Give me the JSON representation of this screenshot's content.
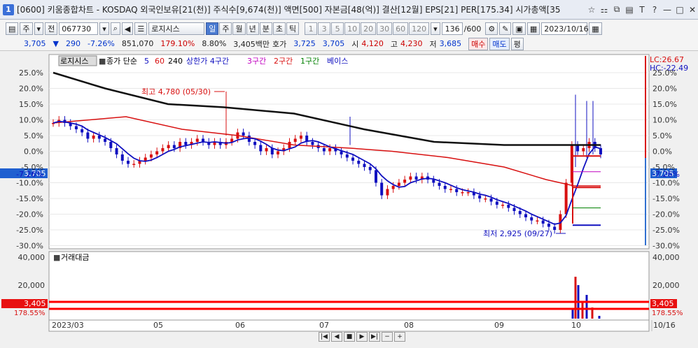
{
  "window": {
    "badge": "1",
    "title": "[0600] 키움종합차트 - KOSDAQ 외국인보유[21(천)] 주식수[9,674(천)] 액면[500] 자본금[48(억)] 결산[12월] EPS[21] PER[175.34] 시가총액[35"
  },
  "toolbar": {
    "market": "주",
    "prev_label": "전",
    "code": "067730",
    "name": "로지시스",
    "period_tabs": [
      "일",
      "주",
      "월",
      "년",
      "분",
      "초",
      "틱"
    ],
    "period_selected": "일",
    "intervals": [
      "1",
      "3",
      "5",
      "10",
      "20",
      "30",
      "60",
      "120"
    ],
    "count": "136",
    "count_total": "/600",
    "date": "2023/10/16"
  },
  "quote": {
    "price": "3,705",
    "change": "290",
    "change_pct": "-7.26%",
    "volume": "851,070",
    "vol_ratio": "179.10%",
    "turnover": "8.80%",
    "amount": "3,405백만",
    "ask_label": "호가",
    "ask": "3,725",
    "bid": "3,705",
    "open_label": "시",
    "open": "4,120",
    "high_label": "고",
    "high": "4,230",
    "low_label": "저",
    "low": "3,685",
    "buy": "매수",
    "sell": "매도",
    "avg": "평"
  },
  "legend": {
    "name": "로지시스",
    "ma_label": "종가 단순",
    "ma5": "5",
    "ma60": "60",
    "ma240": "240",
    "zone1": "상한가 4구간",
    "zone2": "3구간",
    "zone3": "2구간",
    "zone4": "1구간",
    "zone5": "베이스"
  },
  "right_labels": {
    "lc": "LC:26.67",
    "hc": "HC:-22.49"
  },
  "annotations": {
    "high": "최고 4,780 (05/30)",
    "low": "최저 2,925 (09/27)"
  },
  "volume_panel": {
    "label": "거래대금",
    "value": "3,405",
    "ratio": "178.55%"
  },
  "chart_data": {
    "type": "line",
    "price_axis_pct": [
      "25.0%",
      "20.0%",
      "15.0%",
      "10.0%",
      "5.0%",
      "0.0%",
      "-5.0%",
      "-7.26%",
      "-10.0%",
      "-15.0%",
      "-20.0%",
      "-25.0%",
      "-30.0%"
    ],
    "current_price": "3,705",
    "volume_axis": [
      "40,000",
      "20,000"
    ],
    "x_labels": [
      "2023/03",
      "05",
      "06",
      "07",
      "08",
      "09",
      "10",
      "10/16"
    ]
  }
}
